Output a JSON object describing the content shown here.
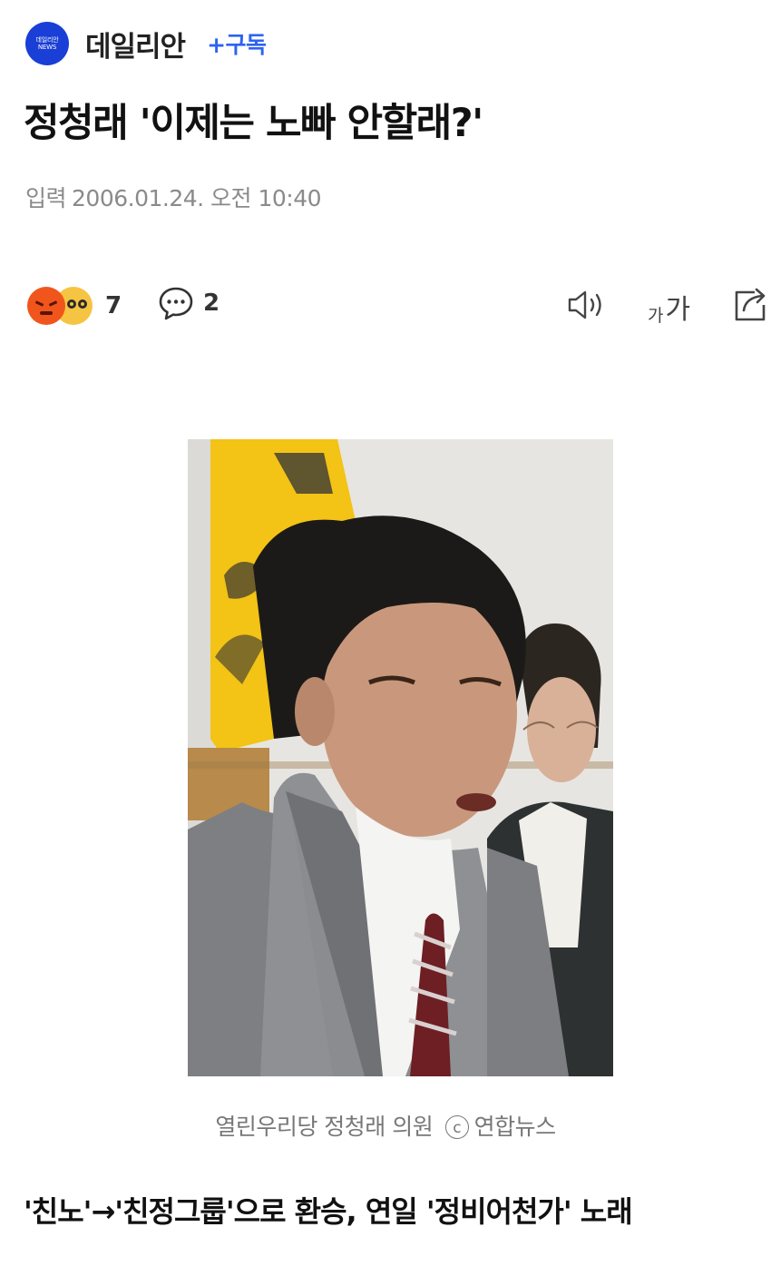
{
  "header": {
    "logo_text_top": "데일리안",
    "logo_text_bottom": "NEWS",
    "press_name": "데일리안",
    "subscribe_label": "+구독"
  },
  "article": {
    "title": "정청래 '이제는 노빠 안할래?'",
    "date_label": "입력",
    "date_value": "2006.01.24. 오전 10:40",
    "photo_caption": "열린우리당 정청래 의원",
    "photo_credit": "연합뉴스",
    "copyright_symbol": "c",
    "subtitle": "'친노'→'친정그룹'으로 환승, 연일 '정비어천가' 노래"
  },
  "toolbar": {
    "reaction_count": "7",
    "comment_count": "2",
    "font_size_small": "가",
    "font_size_big": "가"
  },
  "colors": {
    "logo_bg": "#1a3fd6",
    "subscribe": "#2e63f0",
    "angry_emoji": "#f0561c",
    "nerd_emoji": "#f6c443"
  },
  "icons": [
    "angry-reaction-icon",
    "nerd-reaction-icon",
    "comment-icon",
    "speaker-icon",
    "font-size-icon",
    "share-icon"
  ]
}
